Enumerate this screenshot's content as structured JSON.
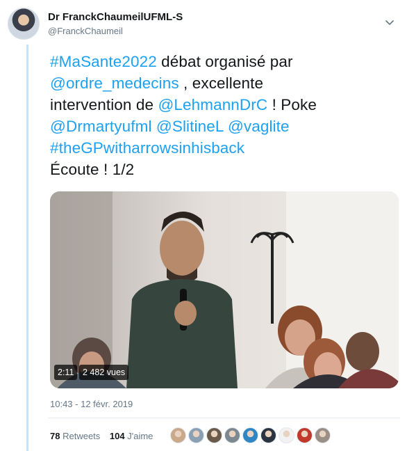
{
  "author": {
    "display_name": "Dr FranckChaumeilUFML-S",
    "handle": "@FranckChaumeil"
  },
  "tweet": {
    "lines": [
      [
        {
          "text": "#MaSante2022",
          "link": true
        },
        {
          "text": " débat organisé par",
          "link": false
        }
      ],
      [
        {
          "text": "@ordre_medecins",
          "link": true
        },
        {
          "text": " , excellente",
          "link": false
        }
      ],
      [
        {
          "text": "intervention de ",
          "link": false
        },
        {
          "text": "@LehmannDrC",
          "link": true
        },
        {
          "text": " ! Poke",
          "link": false
        }
      ],
      [
        {
          "text": "@Drmartyufml",
          "link": true
        },
        {
          "text": " ",
          "link": false
        },
        {
          "text": "@SlitineL",
          "link": true
        },
        {
          "text": " ",
          "link": false
        },
        {
          "text": "@vaglite",
          "link": true
        }
      ],
      [
        {
          "text": "#theGPwitharrowsinhisback",
          "link": true
        }
      ],
      [
        {
          "text": "Écoute !  1/2",
          "link": false
        }
      ]
    ]
  },
  "video": {
    "duration": "2:11",
    "views": "2 482 vues"
  },
  "timestamp": "10:43 - 12 févr. 2019",
  "stats": {
    "retweets_count": "78",
    "retweets_label": "Retweets",
    "likes_count": "104",
    "likes_label": "J'aime"
  },
  "likers": [
    {
      "icon": "liker-avatar-1",
      "color": "#c9a98a"
    },
    {
      "icon": "liker-avatar-2",
      "color": "#8aa0b4"
    },
    {
      "icon": "liker-avatar-3",
      "color": "#6b5a4a"
    },
    {
      "icon": "liker-avatar-4",
      "color": "#7d8891"
    },
    {
      "icon": "liker-avatar-5",
      "color": "#2f86c4"
    },
    {
      "icon": "liker-avatar-6",
      "color": "#2b3340"
    },
    {
      "icon": "liker-avatar-7",
      "color": "#f2f2f2"
    },
    {
      "icon": "liker-avatar-8",
      "color": "#c0392b"
    },
    {
      "icon": "liker-avatar-9",
      "color": "#9a8f86"
    }
  ],
  "colors": {
    "link": "#1da1f2",
    "secondary_text": "#657786",
    "thread_rule": "#c4e4f8"
  }
}
